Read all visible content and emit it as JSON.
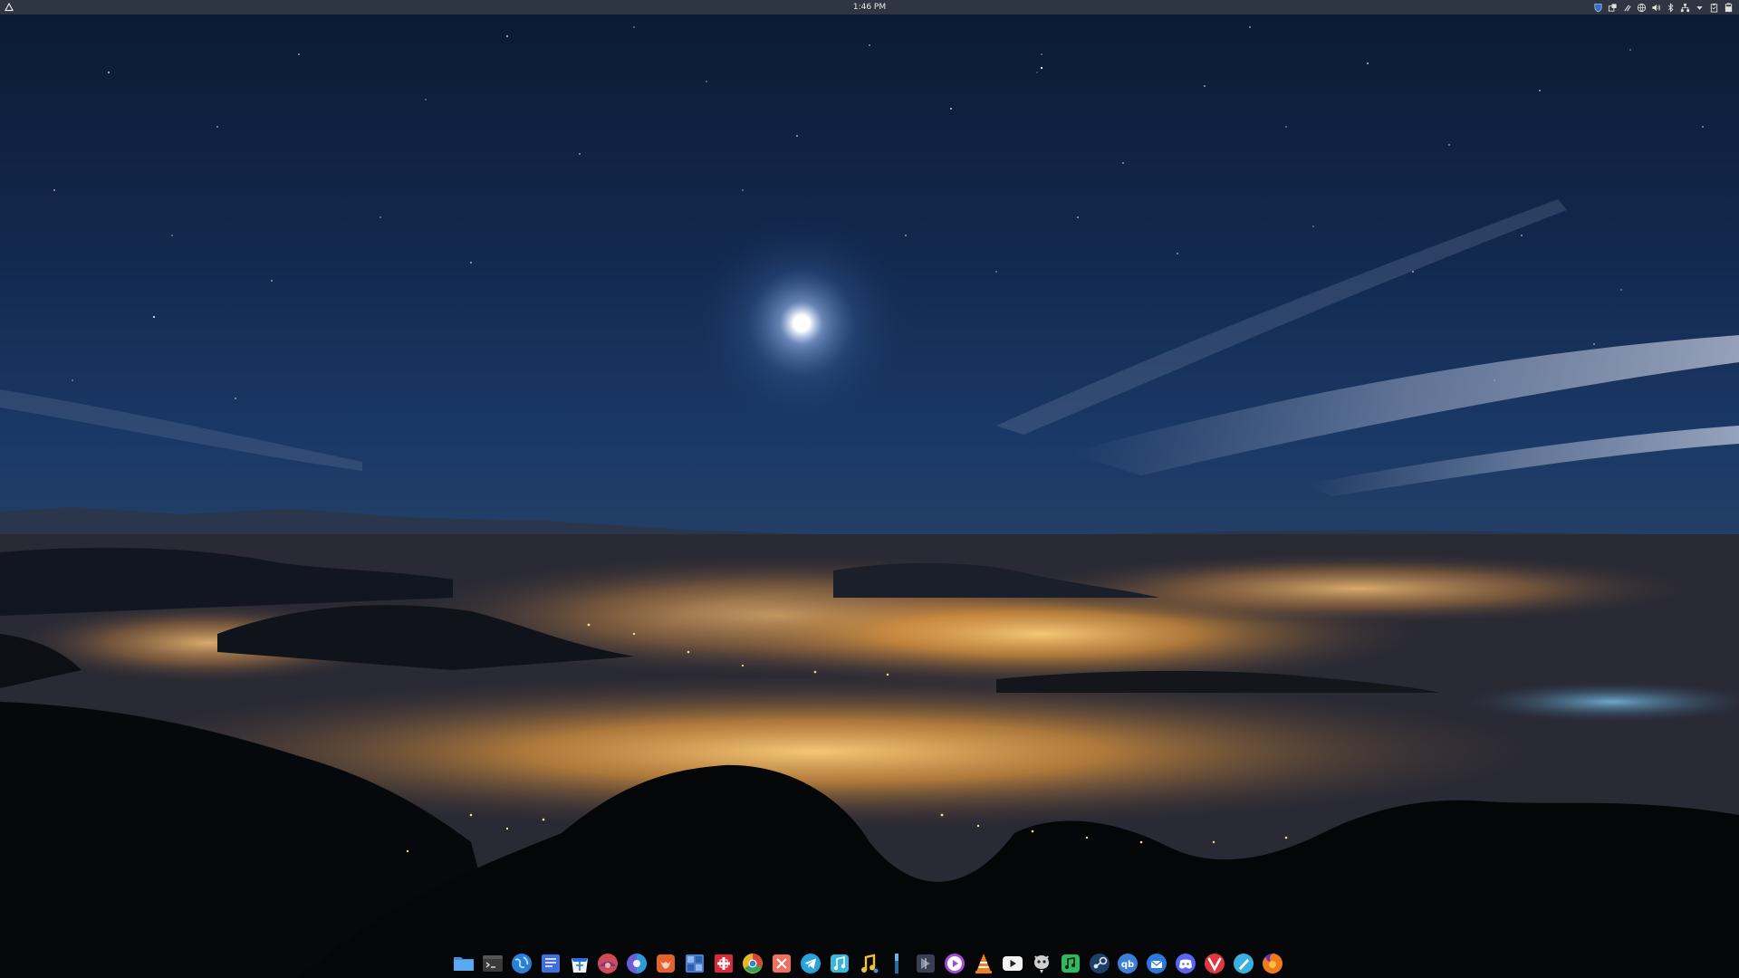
{
  "top_panel": {
    "clock": "1:46 PM",
    "activities_icon": "activities-triangle-icon",
    "tray": [
      {
        "name": "bitwarden-shield-icon",
        "color": "#2f6fd6"
      },
      {
        "name": "window-manager-icon",
        "color": "#e0e0e0"
      },
      {
        "name": "tool-icon",
        "color": "#e0e0e0"
      },
      {
        "name": "vpn-globe-icon",
        "color": "#e0e0e0"
      },
      {
        "name": "volume-icon",
        "color": "#e0e0e0"
      },
      {
        "name": "bluetooth-icon",
        "color": "#e0e0e0"
      },
      {
        "name": "network-icon",
        "color": "#e0e0e0"
      },
      {
        "name": "dropdown-arrow-icon",
        "color": "#e0e0e0"
      },
      {
        "name": "clipboard-icon",
        "color": "#e0e0e0"
      },
      {
        "name": "battery-icon",
        "color": "#e0e0e0"
      }
    ]
  },
  "dock": {
    "apps": [
      {
        "name": "files-app-icon",
        "color": "#3d8fe0"
      },
      {
        "name": "terminal-app-icon",
        "color": "#3a3a3a"
      },
      {
        "name": "browser-globe-app-icon",
        "color": "#2b7fd6"
      },
      {
        "name": "text-editor-app-icon",
        "color": "#3f6fd8"
      },
      {
        "name": "store-app-icon",
        "color": "#2a6fd2"
      },
      {
        "name": "redshift-app-icon",
        "color": "#d04a5a"
      },
      {
        "name": "theme-manager-app-icon",
        "color": "#6b5cd8"
      },
      {
        "name": "gitlab-app-icon",
        "color": "#e2632b"
      },
      {
        "name": "puzzle-app-icon",
        "color": "#4a7fd0"
      },
      {
        "name": "addon-app-icon",
        "color": "#d62b3a"
      },
      {
        "name": "chrome-app-icon",
        "color": "#e8b722"
      },
      {
        "name": "media-tools-app-icon",
        "color": "#f07060"
      },
      {
        "name": "telegram-app-icon",
        "color": "#2aa3dd"
      },
      {
        "name": "music-store-app-icon",
        "color": "#3bb5d8"
      },
      {
        "name": "music-player-app-icon",
        "color": "#f1c232"
      },
      {
        "name": "vertical-bar-app-icon",
        "color": "#2c6c9a"
      },
      {
        "name": "shotcut-app-icon",
        "color": "#3a3f55"
      },
      {
        "name": "media-player-app-icon",
        "color": "#a54dd6"
      },
      {
        "name": "vlc-app-icon",
        "color": "#f07f1e"
      },
      {
        "name": "youtube-app-icon",
        "color": "#f2f2f2"
      },
      {
        "name": "gimp-app-icon",
        "color": "#cfcfcf"
      },
      {
        "name": "spotify-app-icon",
        "color": "#2fb85c"
      },
      {
        "name": "steam-app-icon",
        "color": "#1d3f66"
      },
      {
        "name": "qbittorrent-app-icon",
        "color": "#3c7fd8"
      },
      {
        "name": "thunderbird-app-icon",
        "color": "#2d78e0"
      },
      {
        "name": "discord-app-icon",
        "color": "#5865f2"
      },
      {
        "name": "vivaldi-app-icon",
        "color": "#e0383e"
      },
      {
        "name": "pen-app-icon",
        "color": "#3ab0e0"
      },
      {
        "name": "firefox-app-icon",
        "color": "#f07a1a"
      }
    ]
  }
}
